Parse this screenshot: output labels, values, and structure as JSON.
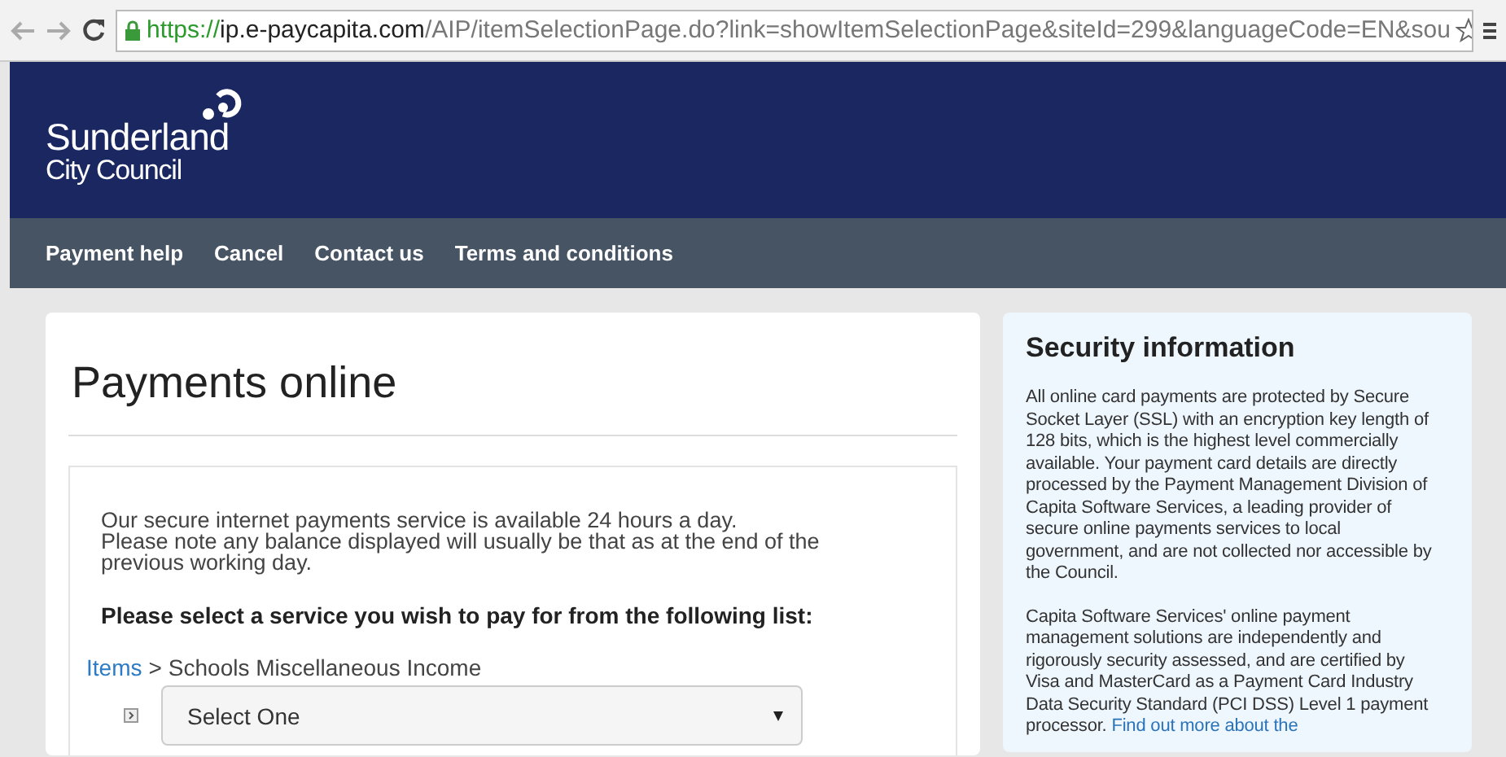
{
  "browser": {
    "url_secure": "https://",
    "url_host": "ip.e-paycapita.com",
    "url_path": "/AIP/itemSelectionPage.do?link=showItemSelectionPage&siteId=299&languageCode=EN&sou"
  },
  "header": {
    "logo_line1": "Sunderland",
    "logo_line2": "City Council"
  },
  "nav": [
    "Payment help",
    "Cancel",
    "Contact us",
    "Terms and conditions"
  ],
  "main": {
    "title": "Payments online",
    "intro": [
      "Our secure internet payments service is available 24 hours a day.",
      "Please note any balance displayed will usually be that as at the end of the previous working day."
    ],
    "prompt": "Please select a service you wish to pay for from the following list:",
    "breadcrumb": [
      {
        "label": "Items",
        "kind": "link"
      },
      {
        "label": ">",
        "kind": "separator"
      },
      {
        "label": "Schools Miscellaneous Income",
        "kind": "current"
      }
    ],
    "select": {
      "value": "Select One"
    }
  },
  "security": {
    "title": "Security information",
    "paragraphs": [
      {
        "text": "All online card payments are protected by Secure Socket Layer (SSL) with an encryption key length of 128 bits, which is the highest level commercially available. Your payment card details are directly processed by the Payment Management Division of Capita Software Services, a leading provider of secure online payments services to local government, and are not collected nor accessible by the Council."
      },
      {
        "text": "Capita Software Services' online payment management solutions are independently and rigorously security assessed, and are certified by Visa and MasterCard as a Payment Card Industry Data Security Standard (PCI DSS) Level 1 payment processor.",
        "link": "Find out more about the"
      }
    ]
  }
}
